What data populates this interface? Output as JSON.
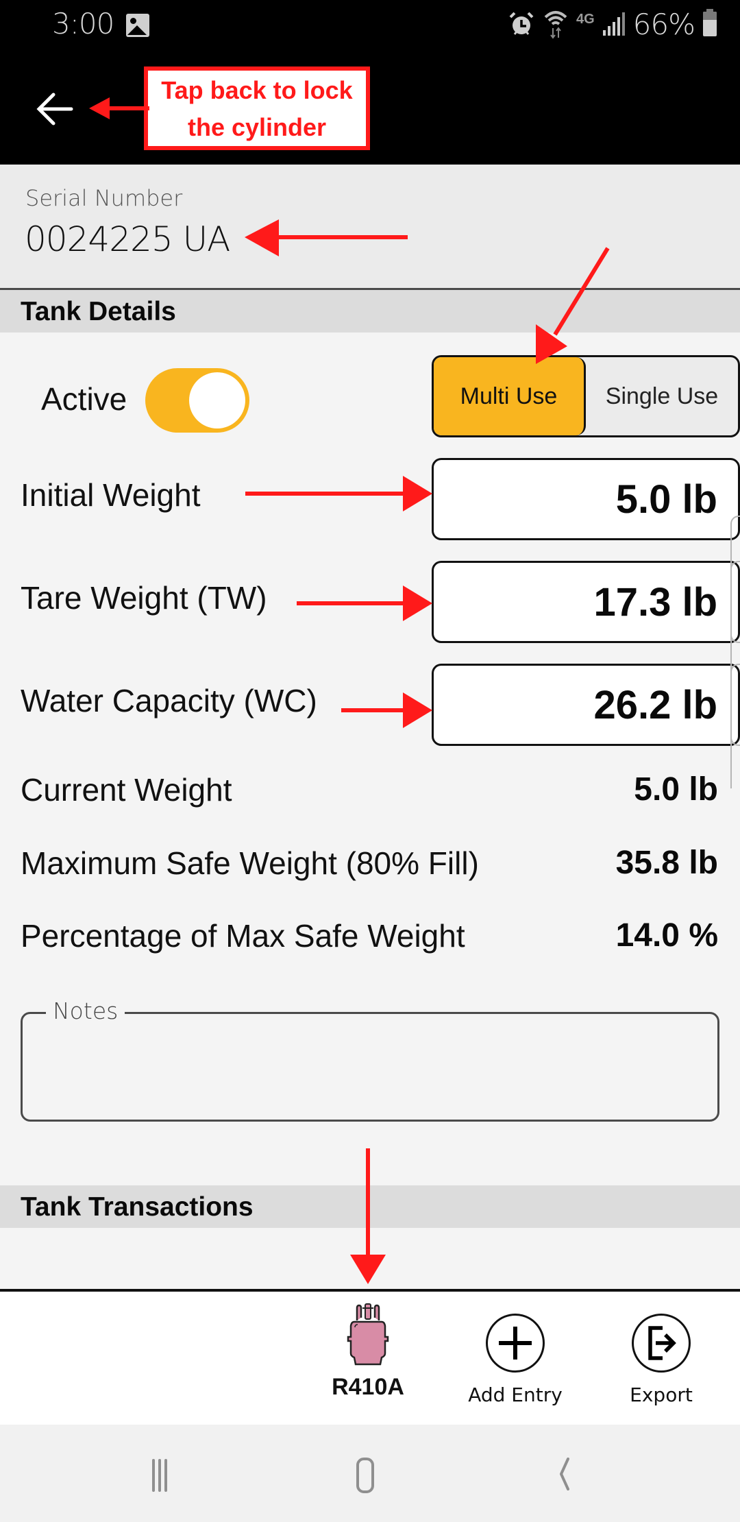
{
  "status_bar": {
    "time": "3:00",
    "network": "4G LTE",
    "battery": "66%",
    "icons": [
      "gallery-icon",
      "alarm-icon",
      "wifi-icon",
      "signal-icon",
      "battery-icon"
    ]
  },
  "app_bar": {
    "back_icon": "arrow-left-icon"
  },
  "annotation": {
    "callout": "Tap back to lock the cylinder",
    "color": "#ff1a1a"
  },
  "serial": {
    "label": "Serial Number",
    "value": "0024225 UA"
  },
  "tank_details": {
    "title": "Tank Details",
    "active_label": "Active",
    "active_on": true,
    "use_type": {
      "options": [
        "Multi Use",
        "Single Use"
      ],
      "selected": "Multi Use"
    },
    "inputs": [
      {
        "label": "Initial Weight",
        "value": "5.0 lb"
      },
      {
        "label": "Tare Weight (TW)",
        "value": "17.3 lb"
      },
      {
        "label": "Water Capacity (WC)",
        "value": "26.2 lb"
      }
    ],
    "calculated": [
      {
        "label": "Current Weight",
        "value": "5.0 lb"
      },
      {
        "label": "Maximum Safe Weight (80% Fill)",
        "value": "35.8 lb"
      },
      {
        "label": "Percentage of Max Safe Weight",
        "value": "14.0 %"
      }
    ],
    "notes": {
      "label": "Notes",
      "value": ""
    }
  },
  "tank_transactions": {
    "title": "Tank Transactions"
  },
  "bottom_bar": {
    "refrigerant": {
      "label": "R410A",
      "icon": "refrigerant-cylinder-icon",
      "color": "#d88ca6"
    },
    "add_entry": {
      "label": "Add Entry",
      "icon": "plus-circle-icon"
    },
    "export": {
      "label": "Export",
      "icon": "export-icon"
    }
  },
  "nav_bar": {
    "buttons": [
      "recent-apps",
      "home",
      "back"
    ]
  },
  "colors": {
    "accent": "#f9b51f",
    "background": "#f4f4f4",
    "header_band": "#dcdcdc"
  }
}
